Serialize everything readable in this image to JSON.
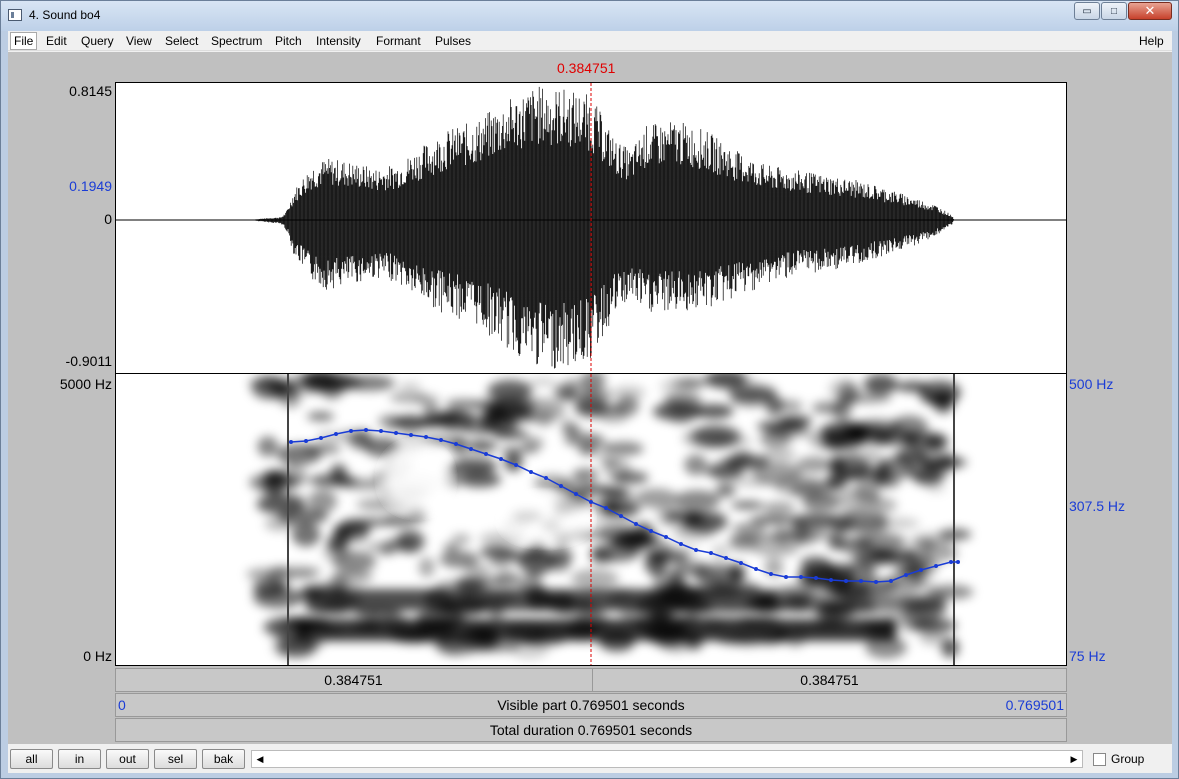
{
  "window": {
    "title": "4. Sound bo4",
    "minimize": "▭",
    "maximize": "□",
    "close": "✕"
  },
  "menu": [
    "File",
    "Edit",
    "Query",
    "View",
    "Select",
    "Spectrum",
    "Pitch",
    "Intensity",
    "Formant",
    "Pulses"
  ],
  "help": "Help",
  "cursor": {
    "time": "0.384751"
  },
  "waveform": {
    "max": "0.8145",
    "cursor_value": "0.1949",
    "zero": "0",
    "min": "-0.9011"
  },
  "spectrogram": {
    "top_freq": "5000 Hz",
    "bottom_freq": "0 Hz"
  },
  "pitch": {
    "top": "500 Hz",
    "cursor": "307.5 Hz",
    "bottom": "75 Hz",
    "color": "#1a3cd6"
  },
  "selection": {
    "left": "0.384751",
    "right": "0.384751"
  },
  "visible": {
    "start": "0",
    "label": "Visible part 0.769501 seconds",
    "end": "0.769501"
  },
  "total": {
    "label": "Total duration 0.769501 seconds"
  },
  "buttons": {
    "all": "all",
    "in": "in",
    "out": "out",
    "sel": "sel",
    "bak": "bak"
  },
  "group": {
    "label": "Group"
  },
  "scroll": {
    "left": "◀",
    "right": "▶"
  }
}
